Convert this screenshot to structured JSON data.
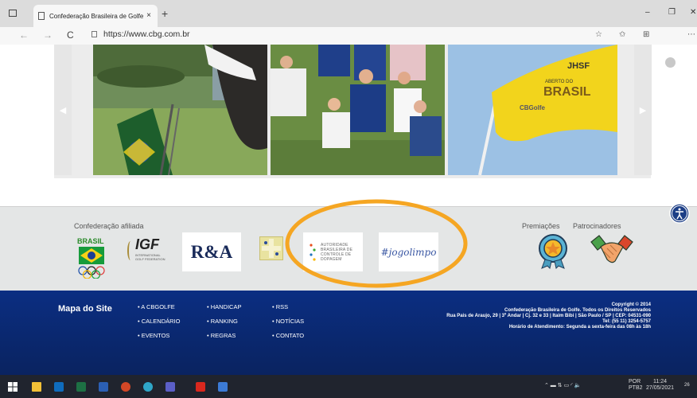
{
  "browser": {
    "tab_title": "Confederação Brasileira de Golfe",
    "tab_close": "×",
    "new_tab": "+",
    "url": "https://www.cbg.com.br",
    "back_icon": "←",
    "forward_icon": "→",
    "reload_icon": "C",
    "minimize": "–",
    "restore": "❐",
    "close": "✕"
  },
  "carousel": {
    "prev_icon": "◀",
    "next_icon": "▶"
  },
  "golf_flag": {
    "text1": "JHSF",
    "text2": "ABERTO DO",
    "text3": "BRASIL",
    "brand": "CBGolfe"
  },
  "footer": {
    "affiliated_label": "Confederação afiliada",
    "awards_label": "Premiações",
    "sponsors_label": "Patrocinadores",
    "logos": {
      "brasil": "BRASIL",
      "igf_mark": "IGF",
      "igf_sub1": "INTERNATIONAL",
      "igf_sub2": "GOLF FEDERATION",
      "rna": "R&A",
      "abcd": [
        "AUTORIDADE",
        "BRASILEIRA DE",
        "CONTROLE DE",
        "DOPAGEM"
      ],
      "jogolimpo": "#jogolimpo"
    }
  },
  "sitemap": {
    "title": "Mapa do Site",
    "col1": [
      "• A CBGOLFE",
      "• CALENDÁRIO",
      "• EVENTOS"
    ],
    "col2": [
      "• HANDICAP",
      "• RANKING",
      "• REGRAS"
    ],
    "col3": [
      "• RSS",
      "• NOTÍCIAS",
      "• CONTATO"
    ],
    "copyright": [
      "Copyright © 2014",
      "Confederação Brasileira de Golfe. Todos os Direitos Reservados",
      "Rua Pais de Araujo, 29 | 3º Andar | Cj. 32 e 33 | Itaim Bibi | São Paulo / SP | CEP: 04531-090",
      "Tel: (55 11) 3254-5757",
      "Horário de Atendimento: Segunda a sexta-feira das 08h às 18h"
    ]
  },
  "taskbar": {
    "lang1": "POR",
    "lang2": "PTB2",
    "time": "11:24",
    "date": "27/05/2021",
    "notif": "26"
  },
  "colors": {
    "highlight_ellipse": "#f5a623",
    "footer_dark": "#0b2e82",
    "footer_light": "#e4e6e6"
  }
}
